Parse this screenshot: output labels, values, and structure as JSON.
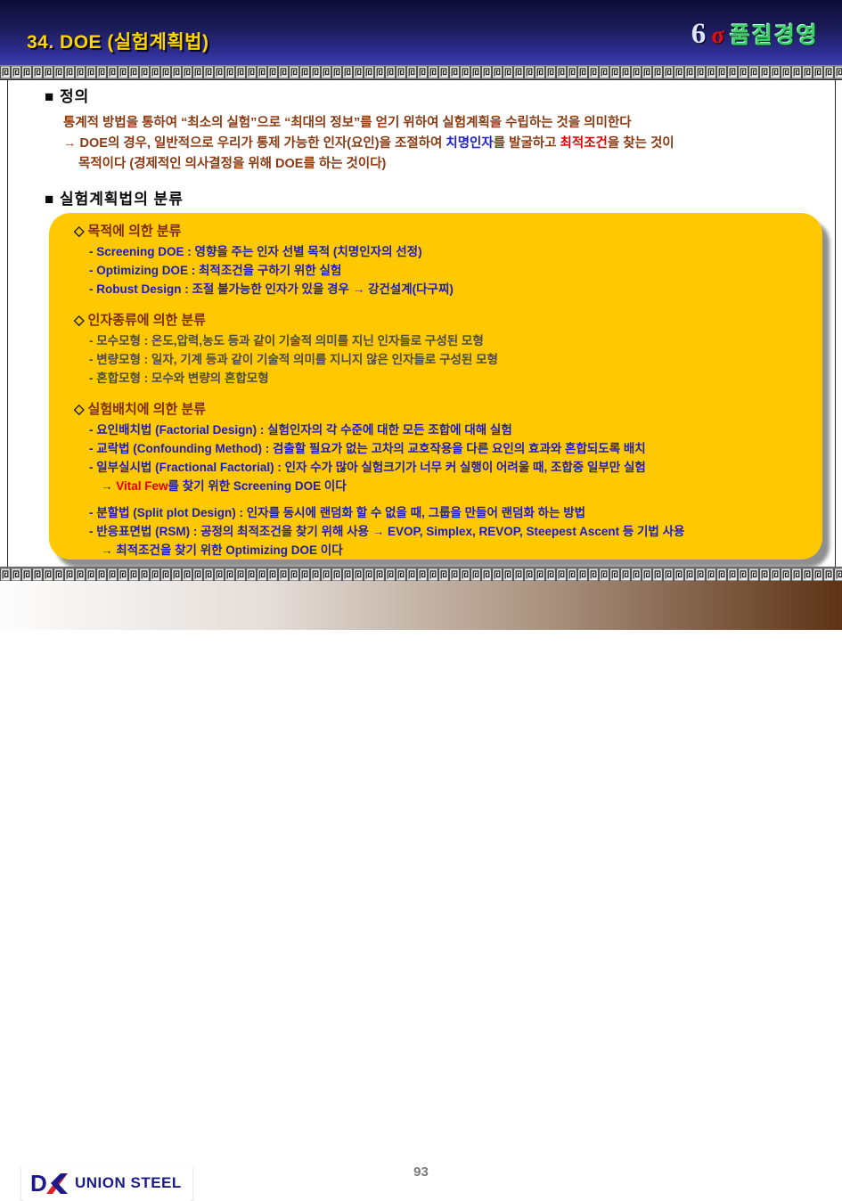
{
  "header": {
    "title": "34. DOE (실험계획법)",
    "badge": {
      "six": "6",
      "sigma": "σ",
      "label": "품질경영"
    }
  },
  "definition": {
    "heading": "■ 정의",
    "line1": "통계적 방법을 통하여 “최소의 실험”으로 “최대의 정보”를 얻기 위하여 실험계획을 수립하는 것을 의미한다",
    "line2": {
      "pre": "→ DOE의 경우, 일반적으로 우리가 통제 가능한 인자(요인)을 조절하여 ",
      "critical": "치명인자",
      "mid": "를 발굴하고 ",
      "optimal": "최적조건",
      "post": "을 찾는 것이"
    },
    "line3": "목적이다 (경제적인 의사결정을 위해 DOE를 하는 것이다)"
  },
  "classification": {
    "heading": "■ 실험계획법의 분류",
    "sections": [
      {
        "marker": "◇",
        "title": "목적에 의한 분류",
        "items": [
          "- Screening DOE : 영향을 주는 인자 선별 목적 (치명인자의 선정)",
          "- Optimizing DOE : 최적조건을 구하기 위한 실험",
          "- Robust Design : 조절 불가능한 인자가 있을 경우 → 강건설계(다구찌)"
        ]
      },
      {
        "marker": "◇",
        "title": "인자종류에 의한 분류",
        "items": [
          "- 모수모형 : 온도,압력,농도 등과 같이 기술적 의미를 지닌 인자들로 구성된 모형",
          "- 변량모형 : 일자, 기계 등과 같이 기술적 의미를 지니지 않은 인자들로 구성된 모형",
          "- 혼합모형 : 모수와 변량의 혼합모형"
        ]
      },
      {
        "marker": "◇",
        "title": "실험배치에 의한 분류",
        "items": [
          "- 요인배치법 (Factorial Design) : 실험인자의 각 수준에 대한 모든 조합에 대해 실험",
          "- 교락법 (Confounding Method) : 검출할 필요가 없는 고차의 교호작용을 다른 요인의 효과와 혼합되도록 배치",
          "- 일부실시법 (Fractional Factorial) : 인자 수가 많아 실험크기가 너무 커 실행이 어려울 때, 조합중 일부만 실험",
          {
            "arrow": "→ ",
            "red": "Vital Few",
            "rest": "를 찾기 위한 Screening DOE 이다"
          },
          "- 분할법 (Split plot Design) : 인자를 동시에 랜덤화 할 수 없을 때, 그룹을 만들어 랜덤화 하는 방법",
          "- 반응표면법 (RSM) : 공정의 최적조건을 찾기 위해 사용 → EVOP, Simplex, REVOP, Steepest Ascent 등 기법 사용",
          {
            "arrow": "→ ",
            "rest": "최적조건을 찾기 위한 Optimizing DOE 이다"
          }
        ]
      }
    ]
  },
  "footer": {
    "brand_mark": "D",
    "brand_text": "UNION STEEL",
    "page_number": "93"
  },
  "colors": {
    "title_yellow": "#FFD400",
    "sigma_red": "#E01010",
    "badge_green": "#3FCE6E",
    "panel_yellow": "#FFC800",
    "body_maroon": "#8A3A12",
    "item_blue": "#1C1CC0",
    "item_gray": "#4A4A4A",
    "accent_red": "#E00000",
    "accent_blue": "#2020C8",
    "header_navy": "#1A1A55",
    "footer_brown": "#5C3316"
  }
}
